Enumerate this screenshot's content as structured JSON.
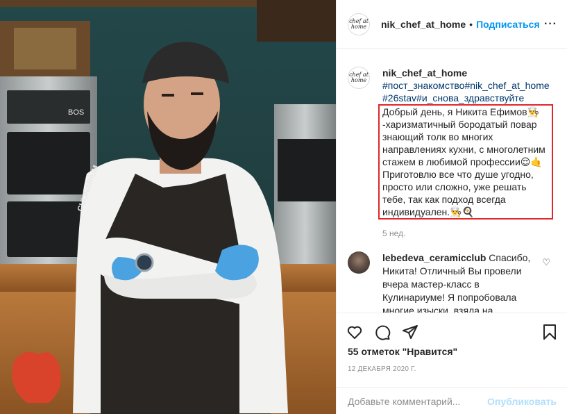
{
  "post": {
    "username": "nik_chef_at_home",
    "follow_label": "Подписаться",
    "dot": "•",
    "more_label": "···",
    "avatar_text": "chef at home",
    "hashtags_line1": "#пост_знакомство#nik_chef_at_home",
    "hashtags_line2": "#26stav#и_снова_здравствуйте",
    "caption_lines": [
      "Добрый день, я Никита Ефимов👨‍🍳",
      "-харизматичный бородатый повар",
      "знающий толк во многих",
      "направлениях кухни, с многолетним",
      "стажем в любимой профессии😌🤙",
      "Приготовлю все что душе угодно,",
      "просто или сложно, уже решать",
      "тебе, так как подход всегда",
      "индивидуален.👨‍🍳🍳"
    ],
    "time_ago": "5 нед."
  },
  "comment": {
    "username": "lebedeva_ceramicclub",
    "text": " Спасибо, Никита! Отличный Вы провели вчера мастер-класс в Кулинариуме! Я попробовала многие изыски, взяла на"
  },
  "actions": {
    "likes": "55 отметок \"Нравится\"",
    "date": "12 ДЕКАБРЯ 2020 Г.",
    "comment_placeholder": "Добавьте комментарий...",
    "publish_label": "Опубликовать"
  },
  "photo": {
    "oven_display": "BOS",
    "brand_label": "CULINARIUM"
  },
  "colors": {
    "link": "#0095f6",
    "hashtag": "#00376b",
    "highlight_box": "#e0262a",
    "muted": "#8e8e8e"
  }
}
